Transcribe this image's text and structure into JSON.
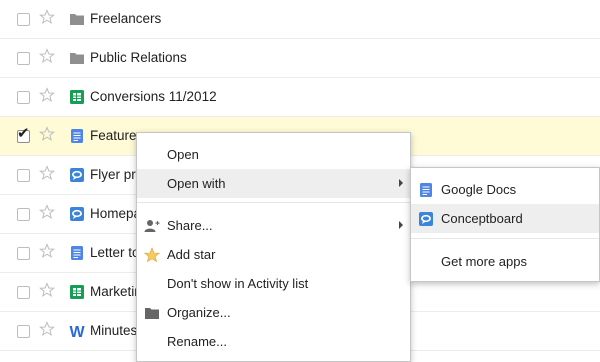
{
  "files": [
    {
      "name": "Freelancers",
      "icon": "folder-icon",
      "selected": false
    },
    {
      "name": "Public Relations",
      "icon": "folder-icon",
      "selected": false
    },
    {
      "name": "Conversions 11/2012",
      "icon": "spreadsheet-icon",
      "selected": false
    },
    {
      "name": "Feature",
      "icon": "document-icon",
      "selected": true
    },
    {
      "name": "Flyer pr",
      "icon": "conceptboard-icon",
      "selected": false
    },
    {
      "name": "Homepa",
      "icon": "conceptboard-icon",
      "selected": false
    },
    {
      "name": "Letter to",
      "icon": "document-icon",
      "selected": false
    },
    {
      "name": "Marketin",
      "icon": "spreadsheet-icon",
      "selected": false
    },
    {
      "name": "Minutes",
      "icon": "word-icon",
      "selected": false
    }
  ],
  "context_menu": {
    "open": "Open",
    "open_with": "Open with",
    "share": "Share...",
    "add_star": "Add star",
    "dont_show_activity": "Don't show in Activity list",
    "organize": "Organize...",
    "rename": "Rename..."
  },
  "open_with_menu": {
    "google_docs": "Google Docs",
    "conceptboard": "Conceptboard",
    "get_more_apps": "Get more apps"
  },
  "colors": {
    "selected_row": "#fffbd6",
    "folder": "#8f8f8f",
    "doc_blue": "#4d86e7",
    "sheet_green": "#169e55",
    "menu_highlight": "#eeeeee"
  }
}
